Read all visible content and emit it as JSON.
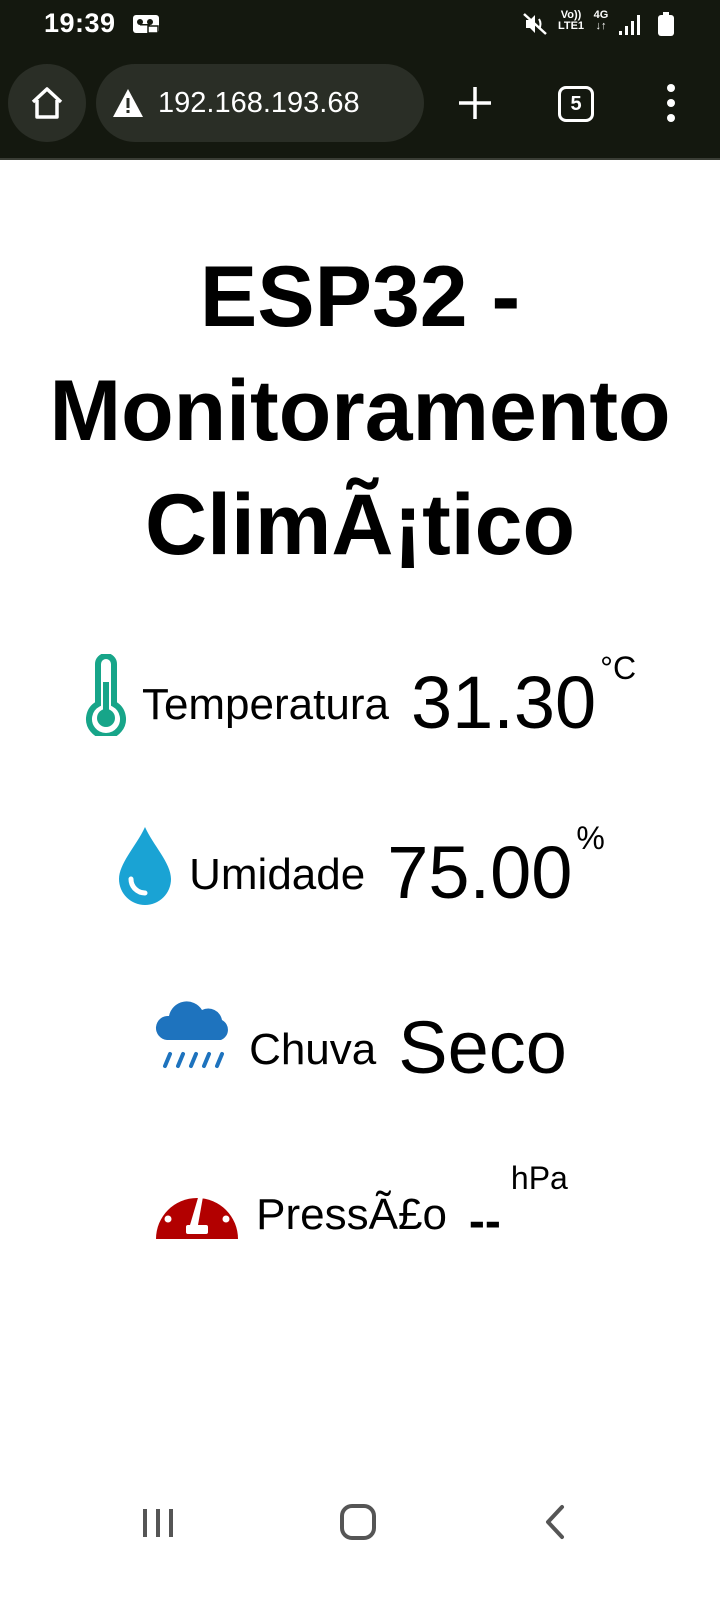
{
  "status_bar": {
    "time": "19:39",
    "volte": "Vo))\nLTE1",
    "network": "4G\n↓↑"
  },
  "browser": {
    "url": "192.168.193.68",
    "tab_count": "5"
  },
  "page": {
    "title": "ESP32 - Monitoramento ClimÃ¡tico",
    "readings": [
      {
        "icon": "thermometer-icon",
        "label": "Temperatura",
        "value": "31.30",
        "unit": "°C",
        "color": "#17a589"
      },
      {
        "icon": "water-drop-icon",
        "label": "Umidade",
        "value": "75.00",
        "unit": "%",
        "color": "#1aa3d4"
      },
      {
        "icon": "cloud-rain-icon",
        "label": "Chuva",
        "value": "Seco",
        "unit": "",
        "color": "#1e73be"
      },
      {
        "icon": "gauge-icon",
        "label": "PressÃ£o",
        "value": "--",
        "unit": "hPa",
        "color": "#b20000"
      }
    ]
  },
  "nav": {
    "icons": [
      "recents-icon",
      "home-icon",
      "back-icon"
    ]
  }
}
